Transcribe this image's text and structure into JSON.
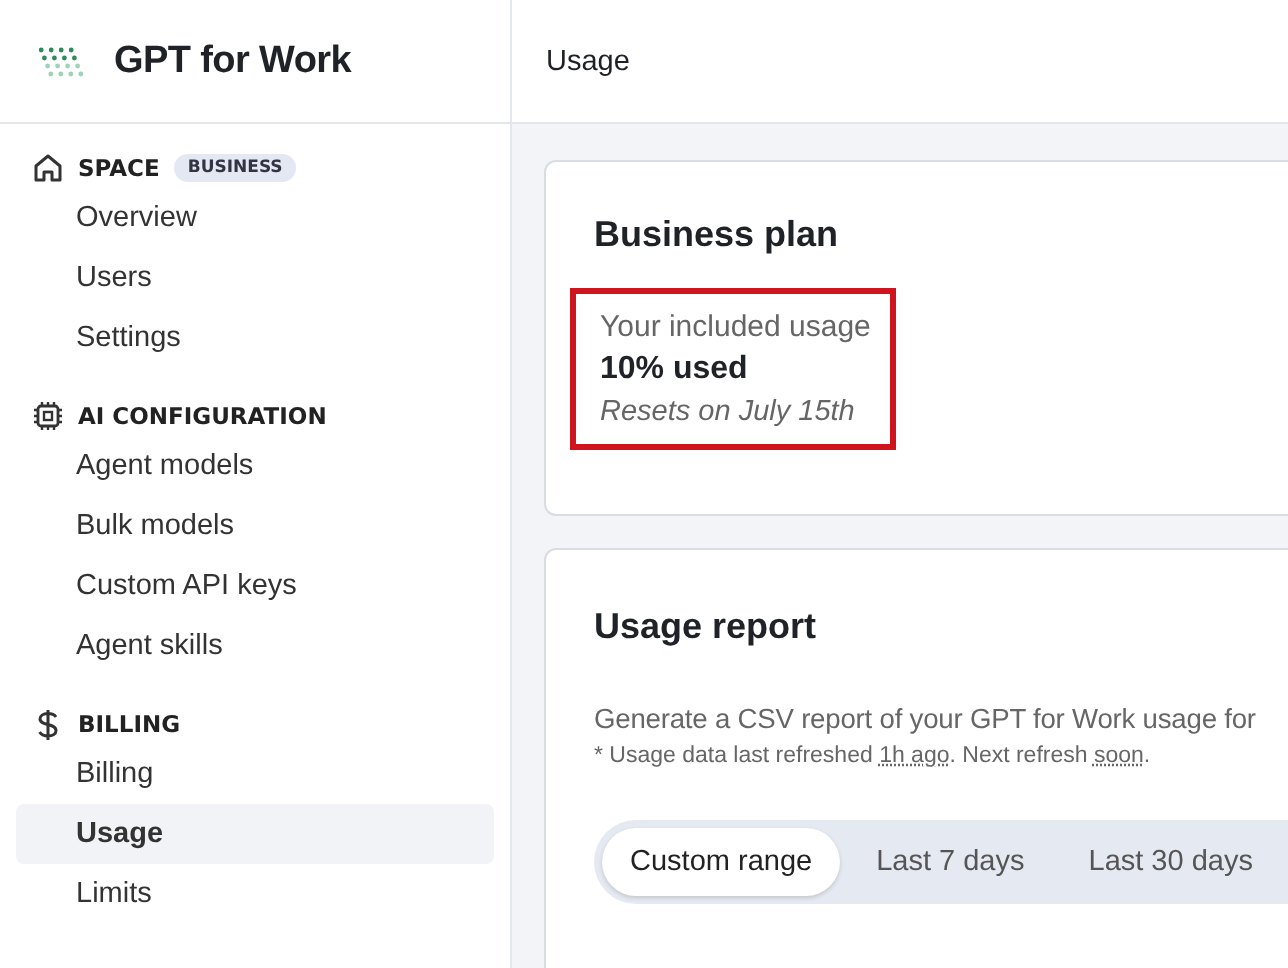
{
  "brand": {
    "name": "GPT for Work"
  },
  "sidebar": {
    "sections": [
      {
        "kind": "home",
        "title": "SPACE",
        "badge": "BUSINESS",
        "items": [
          {
            "label": "Overview",
            "selected": false
          },
          {
            "label": "Users",
            "selected": false
          },
          {
            "label": "Settings",
            "selected": false
          }
        ]
      },
      {
        "kind": "chip",
        "title": "AI CONFIGURATION",
        "items": [
          {
            "label": "Agent models",
            "selected": false
          },
          {
            "label": "Bulk models",
            "selected": false
          },
          {
            "label": "Custom API keys",
            "selected": false
          },
          {
            "label": "Agent skills",
            "selected": false
          }
        ]
      },
      {
        "kind": "dollar",
        "title": "BILLING",
        "items": [
          {
            "label": "Billing",
            "selected": false
          },
          {
            "label": "Usage",
            "selected": true
          },
          {
            "label": "Limits",
            "selected": false
          }
        ]
      }
    ]
  },
  "header": {
    "title": "Usage"
  },
  "plan_card": {
    "title": "Business plan",
    "highlighted": true,
    "label": "Your included usage",
    "used": "10% used",
    "resets": "Resets on July 15th"
  },
  "report_card": {
    "title": "Usage report",
    "description": "Generate a CSV report of your GPT for Work usage for",
    "note": [
      {
        "kind": "text",
        "text": "* Usage data last refreshed "
      },
      {
        "kind": "hint",
        "text": "1h ago"
      },
      {
        "kind": "text",
        "text": ". Next refresh "
      },
      {
        "kind": "hint",
        "text": "soon"
      },
      {
        "kind": "text",
        "text": "."
      }
    ],
    "ranges": [
      {
        "label": "Custom range",
        "selected": true
      },
      {
        "label": "Last 7 days",
        "selected": false
      },
      {
        "label": "Last 30 days",
        "selected": false
      }
    ]
  }
}
